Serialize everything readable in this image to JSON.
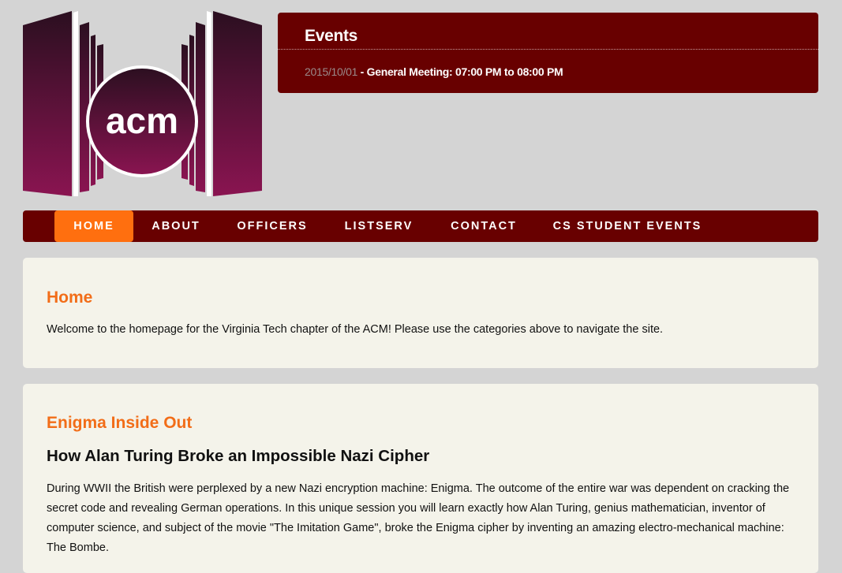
{
  "logo": {
    "text": "acm"
  },
  "events": {
    "title": "Events",
    "items": [
      {
        "date": "2015/10/01",
        "text": " - General Meeting: 07:00 PM to 08:00 PM"
      }
    ]
  },
  "nav": {
    "items": [
      {
        "label": "HOME"
      },
      {
        "label": "ABOUT"
      },
      {
        "label": "OFFICERS"
      },
      {
        "label": "LISTSERV"
      },
      {
        "label": "CONTACT"
      },
      {
        "label": "CS STUDENT EVENTS"
      }
    ]
  },
  "home": {
    "title": "Home",
    "text": "Welcome to the homepage for the Virginia Tech chapter of the ACM! Please use the categories above to navigate the site."
  },
  "enigma": {
    "title": "Enigma Inside Out",
    "subtitle": "How Alan Turing Broke an Impossible Nazi Cipher",
    "body": "During WWII the British were perplexed by a new Nazi encryption machine: Enigma. The outcome of the entire war was dependent on cracking the secret code and revealing German operations. In this unique session you will learn exactly how Alan Turing, genius mathematician, inventor of computer science, and subject of the movie \"The Imitation Game\", broke the Enigma cipher by inventing an amazing electro-mechanical machine: The Bombe."
  },
  "colors": {
    "background": "#d4d4d4",
    "maroon": "#680000",
    "accent_orange": "#ff6f0f",
    "heading_orange": "#f26d18",
    "panel": "#f4f3ea"
  }
}
